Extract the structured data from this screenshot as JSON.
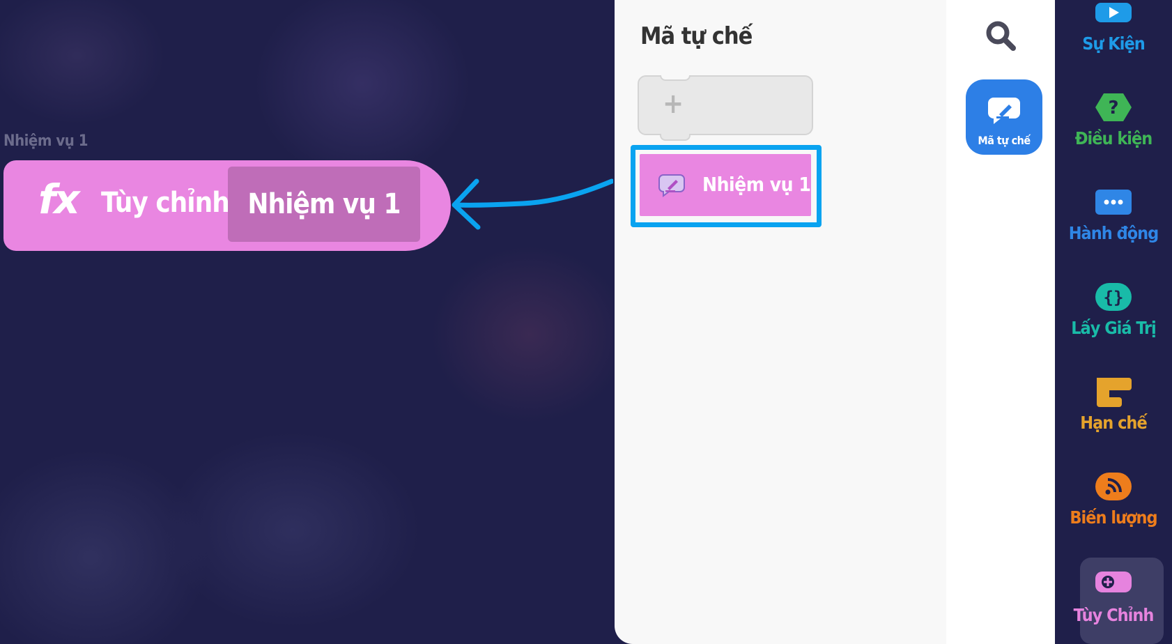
{
  "canvas": {
    "hint_label": "Nhiệm vụ 1",
    "custom_block": {
      "icon": "fx",
      "label": "Tùy chỉnh",
      "name": "Nhiệm vụ 1"
    }
  },
  "panel": {
    "title": "Mã tự chế",
    "add_block_icon": "+",
    "task_block_label": "Nhiệm vụ 1"
  },
  "search": {
    "icon": "search-icon",
    "custom_button_label": "Mã tự chế"
  },
  "categories": [
    {
      "label": "Sự Kiện",
      "color": "#1e9be8",
      "icon": "play-cloud-icon"
    },
    {
      "label": "Điều kiện",
      "color": "#3fb556",
      "icon": "question-hexagon-icon"
    },
    {
      "label": "Hành động",
      "color": "#2f86e6",
      "icon": "ellipsis-bubble-icon"
    },
    {
      "label": "Lấy Giá Trị",
      "color": "#19bba8",
      "icon": "braces-icon"
    },
    {
      "label": "Hạn chế",
      "color": "#e5a32c",
      "icon": "bracket-icon"
    },
    {
      "label": "Biến lượng",
      "color": "#ee7d1c",
      "icon": "feed-icon"
    },
    {
      "label": "Tùy Chỉnh",
      "color": "#e683de",
      "icon": "plus-cloud-icon"
    }
  ],
  "colors": {
    "canvas_bg": "#1f1f4a",
    "custom_block": "#e986e1",
    "custom_block_name_bg": "#bf6db8",
    "highlight": "#0aa3f0",
    "panel_bg": "#f8f8f8",
    "category_button": "#2d7fe6"
  }
}
